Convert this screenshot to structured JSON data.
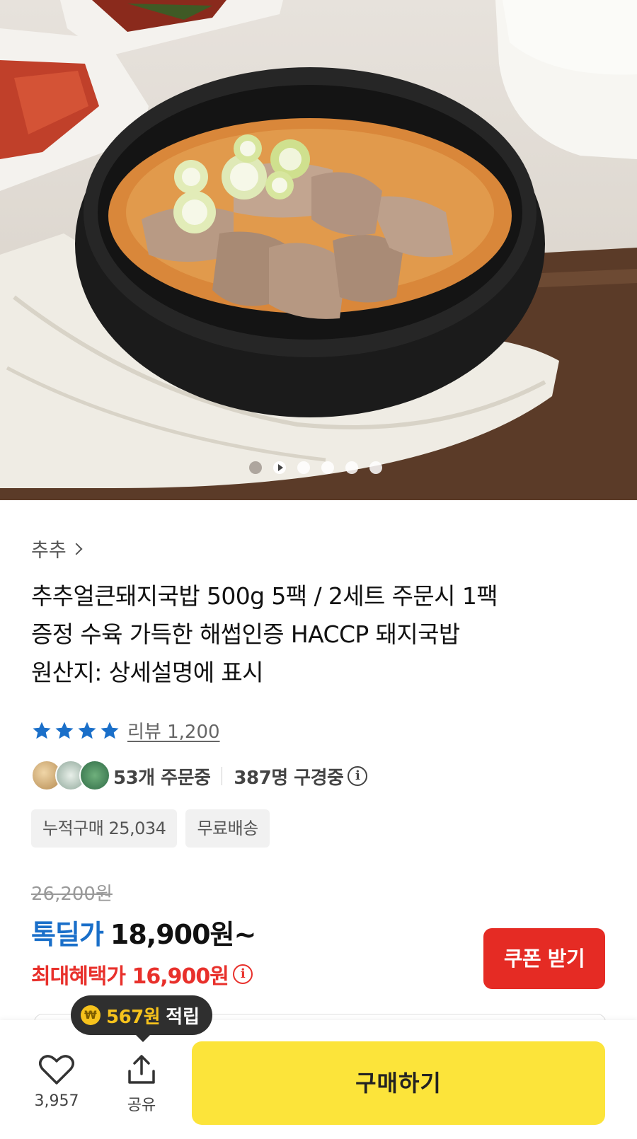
{
  "carousel": {
    "slide_count": 6,
    "active_index": 0,
    "colors": {
      "bowl": "#1b1b1b",
      "soup": "#d9873a",
      "meat": "#b89a84",
      "scallion": "#dfe9b7",
      "tray": "#5b3b28",
      "cloth": "#efece4",
      "kimchi": "#c0402a",
      "rice": "#fbfbf8"
    }
  },
  "product": {
    "brand": "추추",
    "title_lines": [
      "추추얼큰돼지국밥 500g 5팩 / 2세트 주문시 1팩",
      "증정 수육 가득한 해썹인증 HACCP 돼지국밥",
      "원산지: 상세설명에 표시"
    ],
    "rating": {
      "stars": 4,
      "review_label": "리뷰 1,200"
    },
    "ordering_now": "53개 주문중",
    "viewing_now": "387명 구경중",
    "tags": [
      "누적구매 25,034",
      "무료배송"
    ],
    "original_price": "26,200원",
    "deal_label": "톡딜가",
    "deal_price": "18,900원~",
    "max_benefit": "최대혜택가 16,900원",
    "coupon_button": "쿠폰 받기"
  },
  "bottom_bar": {
    "reward_amount": "567원",
    "reward_word": "적립",
    "like_count": "3,957",
    "share_label": "공유",
    "buy_button": "구매하기"
  },
  "colors": {
    "deal_blue": "#1a6fc9",
    "benefit_red": "#e8302b",
    "coupon_red": "#e52b24",
    "buy_yellow": "#fce43a",
    "star_blue": "#1a6fc9"
  }
}
